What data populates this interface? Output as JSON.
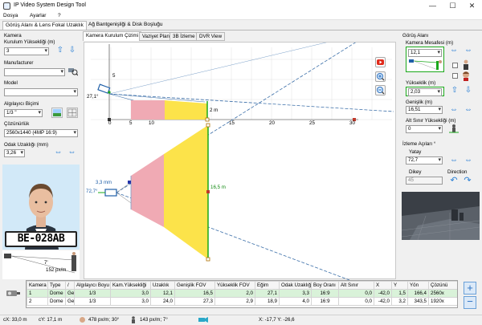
{
  "app": {
    "title": "IP Video System Design Tool"
  },
  "window": {
    "minimize": "—",
    "maximize": "☐",
    "close": "✕"
  },
  "menu": [
    "Dosya",
    "Ayarlar",
    "?"
  ],
  "top_tabs": [
    "Görüş Alanı & Lens Fokal Uzaklık",
    "Ağ Bantgenişliği & Disk Boşluğu"
  ],
  "left": {
    "section": "Kamera",
    "height_label": "Kurulum Yüksekliği (m)",
    "height_value": "3",
    "manufacturer_label": "Manufacturer",
    "manufacturer_value": "",
    "model_label": "Model",
    "model_value": "",
    "sensor_label": "Algılayıcı Biçimi",
    "sensor_value": "1/3 \"",
    "resolution_label": "Çözünürlük",
    "resolution_value": "2560x1440 (4MP 16:9)",
    "focal_label": "Odak Uzaklığı (mm)",
    "focal_value": "3,26",
    "plate_text": "BE-028AB",
    "preview_distance": "7'",
    "preview_density": "152 px/m"
  },
  "center": {
    "tabs": [
      "Kamera Kurulum Çizimi",
      "Vaziyet Planı",
      "3B İzleme",
      "DVR View"
    ],
    "top_angle": "27,1°",
    "top_height_tick": "5",
    "top_x_ticks": [
      "0",
      "5",
      "10",
      "15",
      "20",
      "25",
      "30"
    ],
    "top_height_label": "2 m",
    "bottom_angle": "72,7°",
    "bottom_width_small": "3,3 mm",
    "bottom_width_label": "16,5 m"
  },
  "right": {
    "section": "Görüş Alanı",
    "distance_label": "Kamera Mesafesi  (m)",
    "distance_value": "12,1",
    "height_label": "Yükseklik (m)",
    "height_value": "2,03",
    "width_label": "Genişlik (m)",
    "width_value": "16,51",
    "lower_label": "Alt Sınır Yüksekliği (m)",
    "lower_value": "0",
    "angles_section": "İzleme Açıları °",
    "yaw_label": "Yatay",
    "yaw_value": "72,7",
    "pitch_label": "Dikey",
    "pitch_value": "45",
    "direction_label": "Direction"
  },
  "table": {
    "columns": [
      "Kamera No",
      "Type",
      "/",
      "Algılayıcı Boyu",
      "Kam.Yüksekliği",
      "Uzaklık",
      "Genişlik FOV",
      "Yükseklik FOV",
      "Eğim",
      "Odak Uzaklığı",
      "Boy Oranı",
      "Alt Sınır",
      "X",
      "Y",
      "Yön",
      "Çözünü"
    ],
    "rows": [
      [
        "1",
        "Dome",
        "Ge",
        "1/3",
        "3,0",
        "12,1",
        "16,5",
        "2,0",
        "27,1",
        "3,3",
        "16:9",
        "0,0",
        "-42,0",
        "1,5",
        "166,4",
        "2560x"
      ],
      [
        "2",
        "Dome",
        "Ge",
        "1/3",
        "3,0",
        "24,0",
        "27,3",
        "2,9",
        "18,9",
        "4,0",
        "16:9",
        "0,0",
        "-42,0",
        "3,2",
        "343,5",
        "1920x"
      ]
    ]
  },
  "status": {
    "cx": "cX: 33,0 m",
    "cy": "cY: 17,1 m",
    "px1": "478 px/m; 30°",
    "px2": "143 px/m; 7°",
    "coords": "X: -17,7  Y: -26,6"
  }
}
